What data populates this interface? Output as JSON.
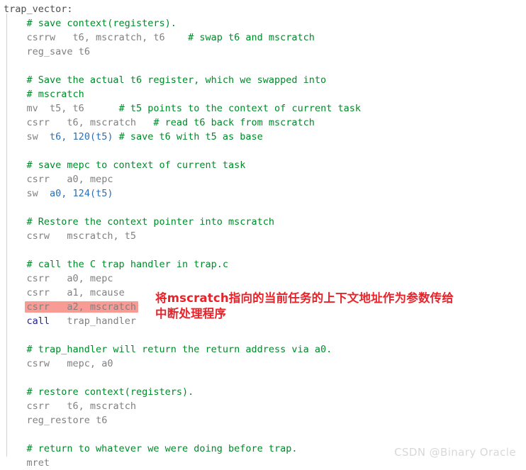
{
  "editor": {
    "language": "riscv-assembly",
    "colors": {
      "background": "#ffffff",
      "comment": "#008a29",
      "code": "#808080",
      "keyword": "#22229c",
      "number": "#2a6fb5",
      "highlight_background": "#f79b94",
      "annotation": "#e8232a",
      "watermark": "#d8d8d8",
      "indent_guide": "#d2d2d2"
    },
    "lines": [
      {
        "id": 1,
        "indent": 0,
        "type": "label",
        "text": "trap_vector:"
      },
      {
        "id": 2,
        "indent": 1,
        "type": "comment",
        "text": "# save context(registers)."
      },
      {
        "id": 3,
        "indent": 1,
        "type": "code",
        "mnemonic": "csrrw",
        "operands": "t6, mscratch, t6",
        "comment": "# swap t6 and mscratch",
        "text": "csrrw   t6, mscratch, t6    # swap t6 and mscratch"
      },
      {
        "id": 4,
        "indent": 1,
        "type": "code",
        "mnemonic": "reg_save",
        "operands": "t6",
        "comment": "",
        "text": "reg_save t6"
      },
      {
        "id": 5,
        "indent": 1,
        "type": "blank",
        "text": ""
      },
      {
        "id": 6,
        "indent": 1,
        "type": "comment",
        "text": "# Save the actual t6 register, which we swapped into"
      },
      {
        "id": 7,
        "indent": 1,
        "type": "comment",
        "text": "# mscratch"
      },
      {
        "id": 8,
        "indent": 1,
        "type": "code",
        "mnemonic": "mv",
        "operands": "t5, t6",
        "comment": "# t5 points to the context of current task",
        "text": "mv  t5, t6      # t5 points to the context of current task"
      },
      {
        "id": 9,
        "indent": 1,
        "type": "code",
        "mnemonic": "csrr",
        "operands": "t6, mscratch",
        "comment": "# read t6 back from mscratch",
        "text": "csrr   t6, mscratch   # read t6 back from mscratch"
      },
      {
        "id": 10,
        "indent": 1,
        "type": "code",
        "mnemonic": "sw",
        "operands": "t6, 120(t5)",
        "comment": "# save t6 with t5 as base",
        "text": "sw  t6, 120(t5) # save t6 with t5 as base"
      },
      {
        "id": 11,
        "indent": 1,
        "type": "blank",
        "text": ""
      },
      {
        "id": 12,
        "indent": 1,
        "type": "comment",
        "text": "# save mepc to context of current task"
      },
      {
        "id": 13,
        "indent": 1,
        "type": "code",
        "mnemonic": "csrr",
        "operands": "a0, mepc",
        "comment": "",
        "text": "csrr   a0, mepc"
      },
      {
        "id": 14,
        "indent": 1,
        "type": "code",
        "mnemonic": "sw",
        "operands": "a0, 124(t5)",
        "comment": "",
        "text": "sw  a0, 124(t5)"
      },
      {
        "id": 15,
        "indent": 1,
        "type": "blank",
        "text": ""
      },
      {
        "id": 16,
        "indent": 1,
        "type": "comment",
        "text": "# Restore the context pointer into mscratch"
      },
      {
        "id": 17,
        "indent": 1,
        "type": "code",
        "mnemonic": "csrw",
        "operands": "mscratch, t5",
        "comment": "",
        "text": "csrw   mscratch, t5"
      },
      {
        "id": 18,
        "indent": 1,
        "type": "blank",
        "text": ""
      },
      {
        "id": 19,
        "indent": 1,
        "type": "comment",
        "text": "# call the C trap handler in trap.c"
      },
      {
        "id": 20,
        "indent": 1,
        "type": "code",
        "mnemonic": "csrr",
        "operands": "a0, mepc",
        "comment": "",
        "text": "csrr   a0, mepc"
      },
      {
        "id": 21,
        "indent": 1,
        "type": "code",
        "mnemonic": "csrr",
        "operands": "a1, mcause",
        "comment": "",
        "text": "csrr   a1, mcause"
      },
      {
        "id": 22,
        "indent": 1,
        "type": "code",
        "mnemonic": "csrr",
        "operands": "a2, mscratch",
        "comment": "",
        "highlighted": true,
        "text": "csrr   a2, mscratch"
      },
      {
        "id": 23,
        "indent": 1,
        "type": "code",
        "mnemonic": "call",
        "operands": "trap_handler",
        "comment": "",
        "keyword": true,
        "text": "call   trap_handler"
      },
      {
        "id": 24,
        "indent": 1,
        "type": "blank",
        "text": ""
      },
      {
        "id": 25,
        "indent": 1,
        "type": "comment",
        "text": "# trap_handler will return the return address via a0."
      },
      {
        "id": 26,
        "indent": 1,
        "type": "code",
        "mnemonic": "csrw",
        "operands": "mepc, a0",
        "comment": "",
        "text": "csrw   mepc, a0"
      },
      {
        "id": 27,
        "indent": 1,
        "type": "blank",
        "text": ""
      },
      {
        "id": 28,
        "indent": 1,
        "type": "comment",
        "text": "# restore context(registers)."
      },
      {
        "id": 29,
        "indent": 1,
        "type": "code",
        "mnemonic": "csrr",
        "operands": "t6, mscratch",
        "comment": "",
        "text": "csrr   t6, mscratch"
      },
      {
        "id": 30,
        "indent": 1,
        "type": "code",
        "mnemonic": "reg_restore",
        "operands": "t6",
        "comment": "",
        "text": "reg_restore t6"
      },
      {
        "id": 31,
        "indent": 1,
        "type": "blank",
        "text": ""
      },
      {
        "id": 32,
        "indent": 1,
        "type": "comment",
        "text": "# return to whatever we were doing before trap."
      },
      {
        "id": 33,
        "indent": 1,
        "type": "code",
        "mnemonic": "mret",
        "operands": "",
        "comment": "",
        "text": "mret"
      }
    ]
  },
  "annotation": {
    "target_line_id": 22,
    "line1": "将mscratch指向的当前任务的上下文地址作为参数传给",
    "line2": "中断处理程序"
  },
  "watermark": {
    "text": "CSDN @Binary Oracle"
  }
}
